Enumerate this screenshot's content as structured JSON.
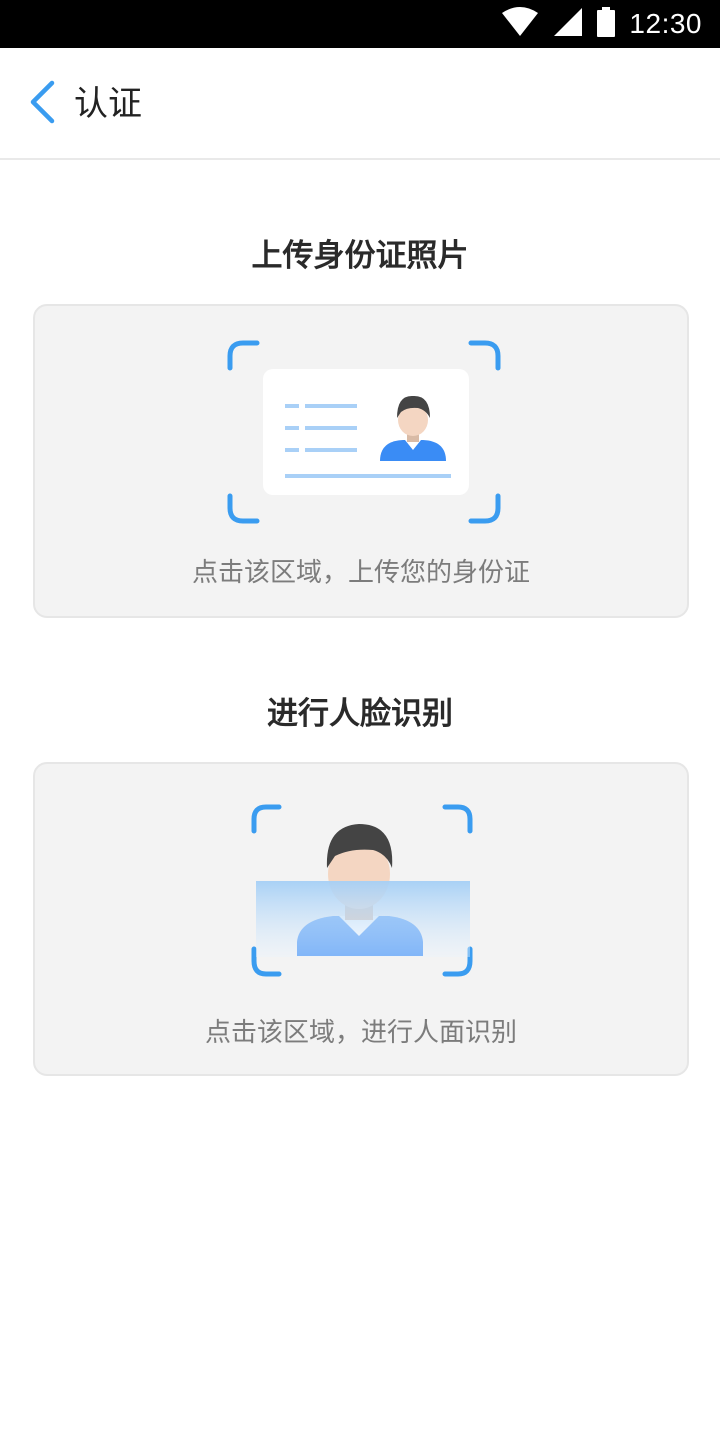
{
  "status_bar": {
    "time": "12:30",
    "icons": [
      "wifi-icon",
      "signal-icon",
      "battery-icon"
    ]
  },
  "header": {
    "back_icon": "chevron-left-icon",
    "title": "认证"
  },
  "id_section": {
    "title": "上传身份证照片",
    "hint": "点击该区域，上传您的身份证",
    "illustration": "id-card-icon"
  },
  "face_section": {
    "title": "进行人脸识别",
    "hint": "点击该区域，进行人面识别",
    "illustration": "face-scan-icon"
  },
  "colors": {
    "accent": "#3a9cf0",
    "shirt_blue": "#3a8cf5",
    "card_bg": "#f3f3f3",
    "hint_text": "#7c7c7c"
  }
}
